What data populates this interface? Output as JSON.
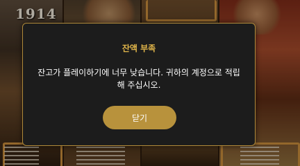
{
  "background": {
    "year_text": "1914"
  },
  "dialog": {
    "title": "잔액 부족",
    "message": "잔고가 플레이하기에 너무 낮습니다. 귀하의 계정으로 적립해 주십시오.",
    "close_label": "닫기"
  },
  "colors": {
    "title_accent": "#e2b64a",
    "button": "#b8923c",
    "dialog_bg": "#1c1c1c",
    "dialog_border": "#b08a3a"
  }
}
